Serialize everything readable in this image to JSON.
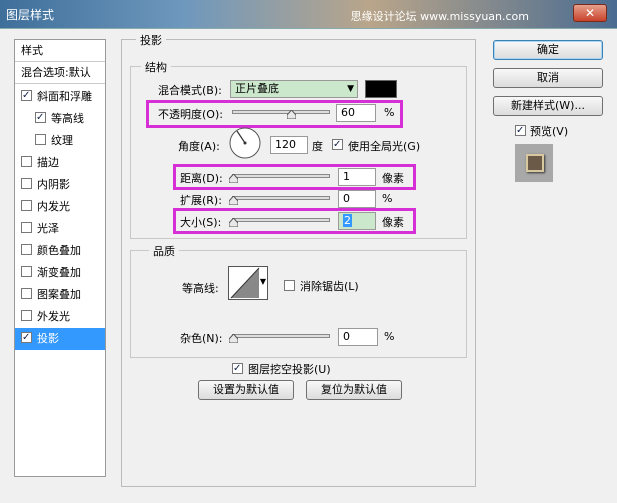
{
  "window": {
    "title": "图层样式",
    "watermark": "思缘设计论坛 www.missyuan.com",
    "close_label": "✕"
  },
  "stylelist": {
    "items": [
      {
        "label": "样式",
        "checkbox": false,
        "checked": false,
        "selected": false
      },
      {
        "label": "混合选项:默认",
        "checkbox": false,
        "checked": false,
        "selected": false
      },
      {
        "label": "斜面和浮雕",
        "checkbox": true,
        "checked": true,
        "selected": false
      },
      {
        "label": "等高线",
        "checkbox": true,
        "checked": true,
        "selected": false
      },
      {
        "label": "纹理",
        "checkbox": true,
        "checked": false,
        "selected": false
      },
      {
        "label": "描边",
        "checkbox": true,
        "checked": false,
        "selected": false
      },
      {
        "label": "内阴影",
        "checkbox": true,
        "checked": false,
        "selected": false
      },
      {
        "label": "内发光",
        "checkbox": true,
        "checked": false,
        "selected": false
      },
      {
        "label": "光泽",
        "checkbox": true,
        "checked": false,
        "selected": false
      },
      {
        "label": "颜色叠加",
        "checkbox": true,
        "checked": false,
        "selected": false
      },
      {
        "label": "渐变叠加",
        "checkbox": true,
        "checked": false,
        "selected": false
      },
      {
        "label": "图案叠加",
        "checkbox": true,
        "checked": false,
        "selected": false
      },
      {
        "label": "外发光",
        "checkbox": true,
        "checked": false,
        "selected": false
      },
      {
        "label": "投影",
        "checkbox": true,
        "checked": true,
        "selected": true
      }
    ]
  },
  "panel": {
    "section_title": "投影",
    "structure": {
      "legend": "结构",
      "blend_mode_label": "混合模式(B):",
      "blend_mode_value": "正片叠底",
      "shadow_color": "#000000",
      "opacity_label": "不透明度(O):",
      "opacity_value": "60",
      "opacity_unit": "%",
      "angle_label": "角度(A):",
      "angle_value": "120",
      "angle_unit": "度",
      "use_global_light_label": "使用全局光(G)",
      "use_global_light": true,
      "distance_label": "距离(D):",
      "distance_value": "1",
      "distance_unit": "像素",
      "spread_label": "扩展(R):",
      "spread_value": "0",
      "spread_unit": "%",
      "size_label": "大小(S):",
      "size_value": "2",
      "size_unit": "像素"
    },
    "quality": {
      "legend": "品质",
      "contour_label": "等高线:",
      "anti_alias_label": "消除锯齿(L)",
      "anti_alias": false,
      "noise_label": "杂色(N):",
      "noise_value": "0",
      "noise_unit": "%"
    },
    "knockout_label": "图层挖空投影(U)",
    "knockout": true,
    "make_default_label": "设置为默认值",
    "reset_default_label": "复位为默认值"
  },
  "buttons": {
    "ok_label": "确定",
    "cancel_label": "取消",
    "new_style_label": "新建样式(W)...",
    "preview_label": "预览(V)",
    "preview": true
  },
  "highlight_color": "#d62fd6"
}
